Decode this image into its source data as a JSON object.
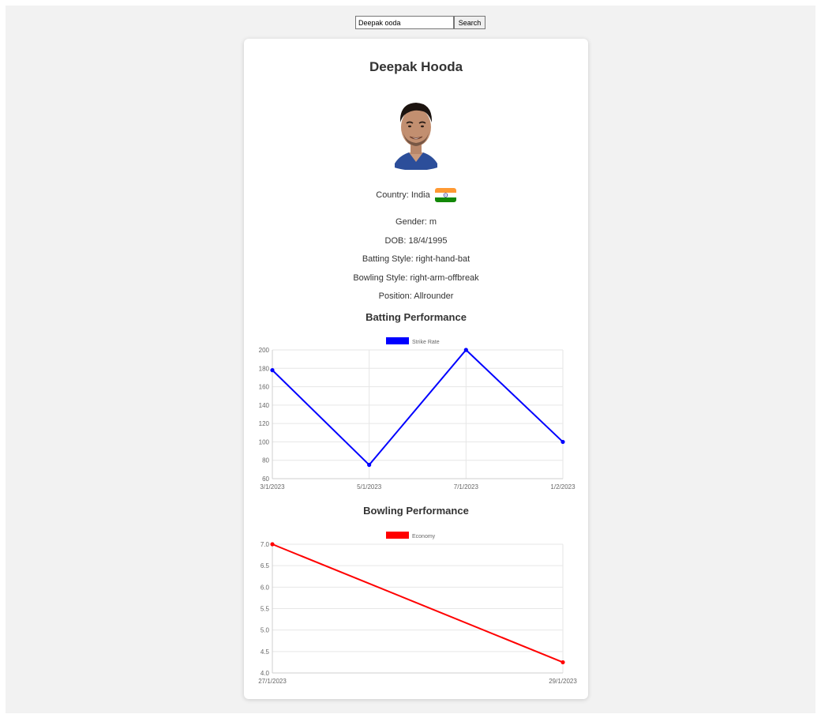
{
  "search": {
    "value": "Deepak ooda",
    "button_label": "Search"
  },
  "player": {
    "name": "Deepak Hooda",
    "country_text": "Country: India",
    "gender_text": "Gender: m",
    "dob_text": "DOB: 18/4/1995",
    "batting_style_text": "Batting Style: right-hand-bat",
    "bowling_style_text": "Bowling Style: right-arm-offbreak",
    "position_text": "Position: Allrounder"
  },
  "colors": {
    "batting_line": "#0000ff",
    "bowling_line": "#ff0000"
  },
  "chart_data": [
    {
      "type": "line",
      "title": "Batting Performance",
      "categories": [
        "3/1/2023",
        "5/1/2023",
        "7/1/2023",
        "1/2/2023"
      ],
      "series": [
        {
          "name": "Strike Rate",
          "values": [
            178,
            75,
            200,
            100
          ]
        }
      ],
      "ylim": [
        60,
        200
      ],
      "yticks": [
        60,
        80,
        100,
        120,
        140,
        160,
        180,
        200
      ],
      "grid": true,
      "legend": "top"
    },
    {
      "type": "line",
      "title": "Bowling Performance",
      "categories": [
        "27/1/2023",
        "29/1/2023"
      ],
      "series": [
        {
          "name": "Economy",
          "values": [
            7.0,
            4.25
          ]
        }
      ],
      "ylim": [
        4.0,
        7.0
      ],
      "yticks": [
        "4.0",
        "4.5",
        "5.0",
        "5.5",
        "6.0",
        "6.5",
        "7.0"
      ],
      "grid": true,
      "legend": "top"
    }
  ]
}
